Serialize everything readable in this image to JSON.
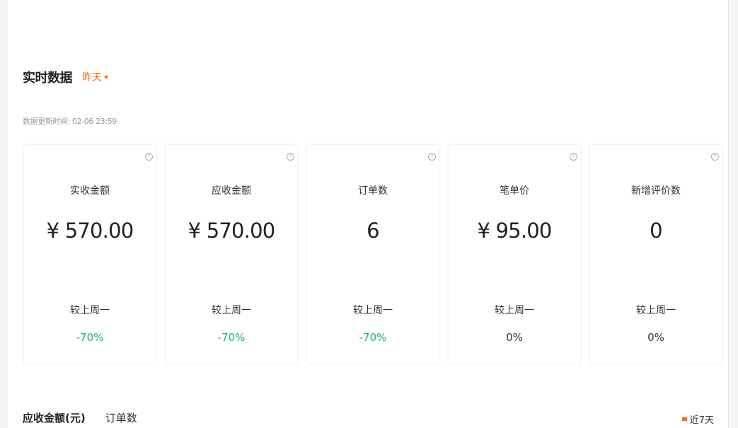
{
  "realtime": {
    "title": "实时数据",
    "range_selected": "昨天",
    "update_time": "数据更新时间: 02-06 23:59"
  },
  "cards": [
    {
      "label": "实收金额",
      "value": "¥ 570.00",
      "compare_label": "较上周一",
      "compare_value": "-70%",
      "trend": "down"
    },
    {
      "label": "应收金额",
      "value": "¥ 570.00",
      "compare_label": "较上周一",
      "compare_value": "-70%",
      "trend": "down"
    },
    {
      "label": "订单数",
      "value": "6",
      "compare_label": "较上周一",
      "compare_value": "-70%",
      "trend": "down"
    },
    {
      "label": "笔单价",
      "value": "¥ 95.00",
      "compare_label": "较上周一",
      "compare_value": "0%",
      "trend": "flat"
    },
    {
      "label": "新增评价数",
      "value": "0",
      "compare_label": "较上周一",
      "compare_value": "0%",
      "trend": "flat"
    }
  ],
  "chart_section": {
    "tabs": [
      {
        "label": "应收金额(元)",
        "active": true
      },
      {
        "label": "订单数",
        "active": false
      }
    ],
    "legend_label": "近7天"
  },
  "colors": {
    "accent": "#ff6a00",
    "trend_down": "#1cae8f",
    "text": "#333333"
  },
  "icons": {
    "help": "help-icon",
    "dropdown": "caret-down-icon"
  }
}
